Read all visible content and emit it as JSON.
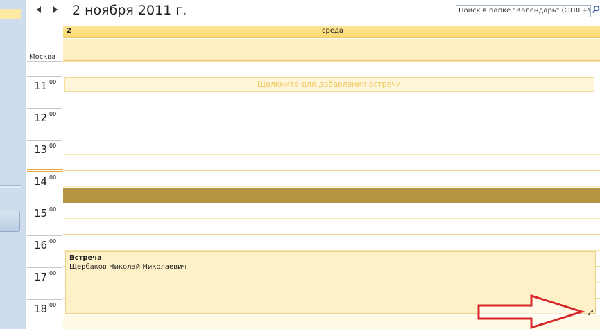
{
  "header": {
    "date_title": "2 ноября 2011 г.",
    "search_placeholder": "Поиск в папке \"Календарь\" (CTRL+У)",
    "prev_icon": "chevron-left-icon",
    "next_icon": "chevron-right-icon",
    "search_icon": "search-icon"
  },
  "timezone": "Москва",
  "hours": [
    {
      "hour": "11",
      "minutes": "00"
    },
    {
      "hour": "12",
      "minutes": "00"
    },
    {
      "hour": "13",
      "minutes": "00"
    },
    {
      "hour": "14",
      "minutes": "00"
    },
    {
      "hour": "15",
      "minutes": "00"
    },
    {
      "hour": "16",
      "minutes": "00"
    },
    {
      "hour": "17",
      "minutes": "00"
    },
    {
      "hour": "18",
      "minutes": "00"
    }
  ],
  "day": {
    "number": "2",
    "weekday": "среда",
    "add_prompt": "Щелкните для добавления встречи"
  },
  "appointment": {
    "title": "Встреча",
    "organizer": "Щербаков Николай Николаевич"
  },
  "colors": {
    "accent_yellow": "#fdd86e",
    "busy_band": "#b59640",
    "annotation_red": "#d9262b",
    "nav_blue": "#cfdced"
  }
}
